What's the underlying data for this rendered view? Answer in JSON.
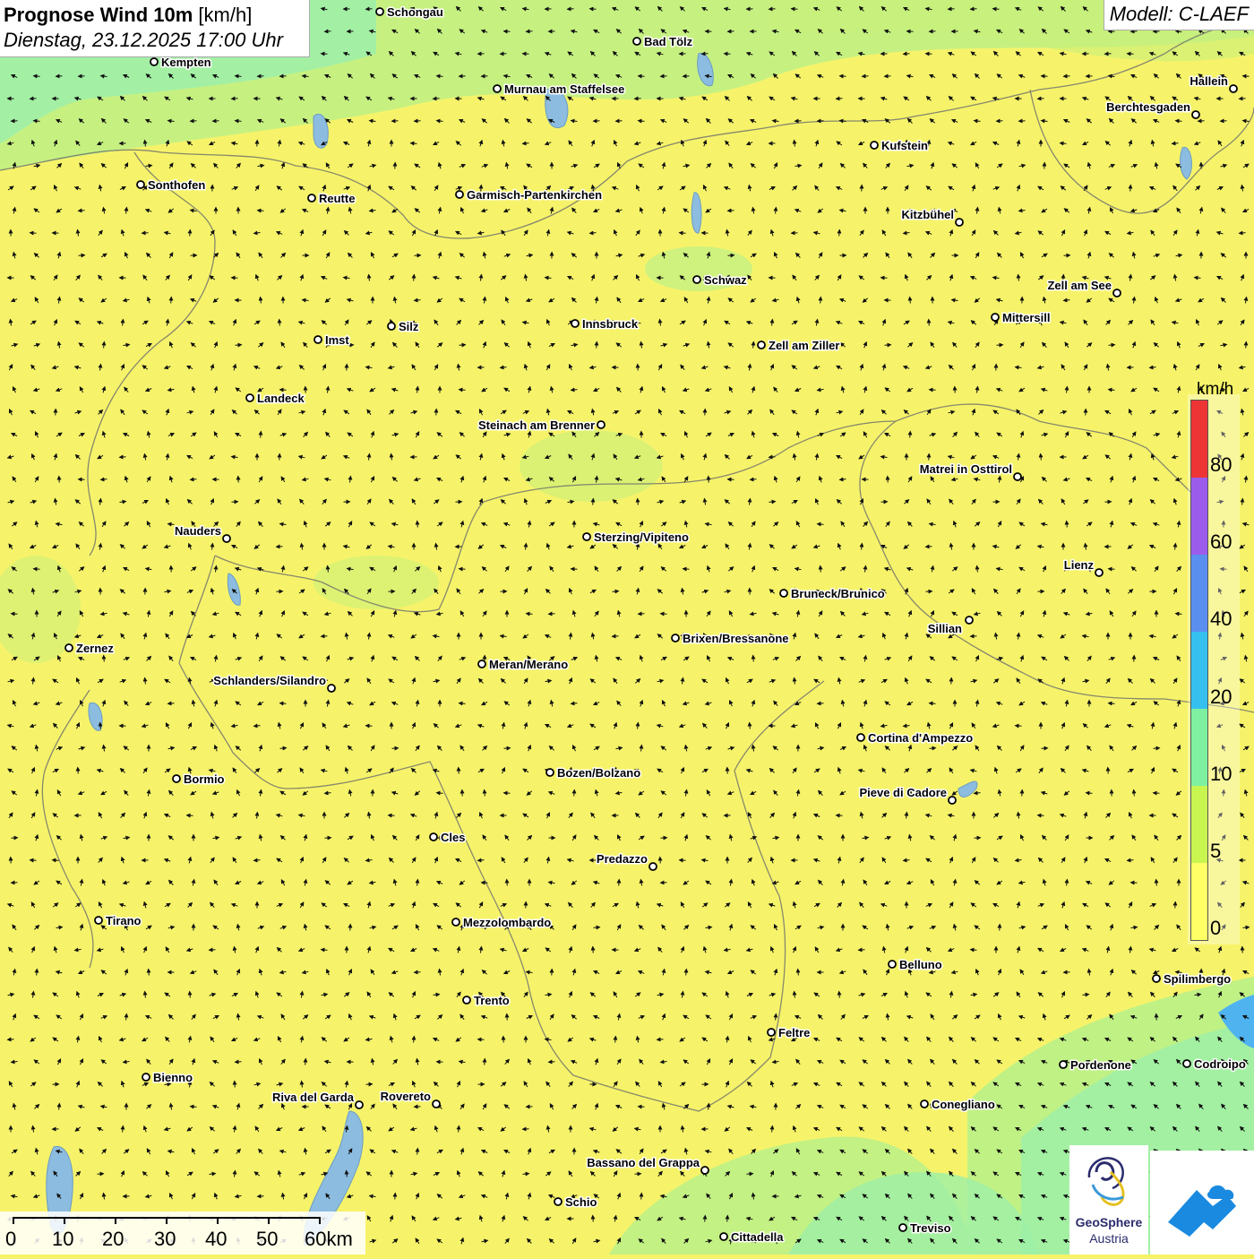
{
  "header": {
    "title_bold": "Prognose Wind 10m",
    "title_unit": "[km/h]",
    "date": "Dienstag, 23.12.2025 17:00 Uhr",
    "model": "Modell: C-LAEF"
  },
  "legend": {
    "unit": "km/h",
    "colors": [
      "#ee3535",
      "#9b5cec",
      "#5a8ff0",
      "#35c0f0",
      "#7ff0a0",
      "#c8f550",
      "#ffff66"
    ],
    "labels": [
      "80",
      "60",
      "40",
      "20",
      "10",
      "5",
      "0"
    ]
  },
  "scale_bar": {
    "labels": [
      "0",
      "10",
      "20",
      "30",
      "40",
      "50",
      "60km"
    ]
  },
  "cities": [
    {
      "name": "Schongau"
    },
    {
      "name": "Bad Tölz"
    },
    {
      "name": "Kempten"
    },
    {
      "name": "Murnau am Staffelsee"
    },
    {
      "name": "Hallein"
    },
    {
      "name": "Berchtesgaden"
    },
    {
      "name": "Kufstein"
    },
    {
      "name": "Sonthofen"
    },
    {
      "name": "Reutte"
    },
    {
      "name": "Garmisch-Partenkirchen"
    },
    {
      "name": "Kitzbühel"
    },
    {
      "name": "Schwaz"
    },
    {
      "name": "Zell am See"
    },
    {
      "name": "Mittersill"
    },
    {
      "name": "Imst"
    },
    {
      "name": "Silz"
    },
    {
      "name": "Innsbruck"
    },
    {
      "name": "Zell am Ziller"
    },
    {
      "name": "Landeck"
    },
    {
      "name": "Steinach am Brenner"
    },
    {
      "name": "Matrei in Osttirol"
    },
    {
      "name": "Nauders"
    },
    {
      "name": "Sterzing/Vipiteno"
    },
    {
      "name": "Lienz"
    },
    {
      "name": "Bruneck/Brunico"
    },
    {
      "name": "Sillian"
    },
    {
      "name": "Zernez"
    },
    {
      "name": "Brixen/Bressanone"
    },
    {
      "name": "Meran/Merano"
    },
    {
      "name": "Schlanders/Silandro"
    },
    {
      "name": "Cortina d'Ampezzo"
    },
    {
      "name": "Bozen/Bolzano"
    },
    {
      "name": "Bormio"
    },
    {
      "name": "Pieve di Cadore"
    },
    {
      "name": "Cles"
    },
    {
      "name": "Predazzo"
    },
    {
      "name": "Tirano"
    },
    {
      "name": "Mezzolombardo"
    },
    {
      "name": "Belluno"
    },
    {
      "name": "Spilimbergo"
    },
    {
      "name": "Trento"
    },
    {
      "name": "Feltre"
    },
    {
      "name": "Bienno"
    },
    {
      "name": "Pordenone"
    },
    {
      "name": "Codroipo"
    },
    {
      "name": "Riva del Garda"
    },
    {
      "name": "Rovereto"
    },
    {
      "name": "Conegliano"
    },
    {
      "name": "Bassano del Grappa"
    },
    {
      "name": "Schio"
    },
    {
      "name": "Treviso"
    },
    {
      "name": "Cittadella"
    }
  ],
  "logo": {
    "line1": "GeoSphere",
    "line2": "Austria"
  },
  "colors": {
    "calm": "#f6f36a",
    "light": "#c8f07a",
    "breeze": "#9ef0a8"
  }
}
